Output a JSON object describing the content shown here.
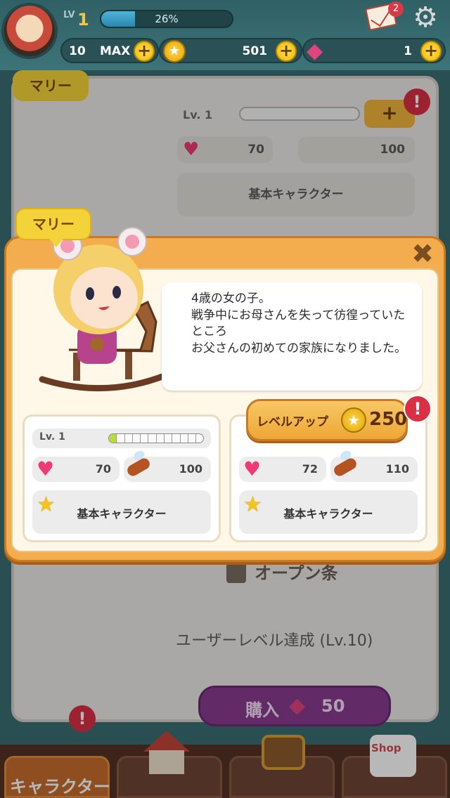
{
  "topbar": {
    "lv_tag": "LV",
    "level": "1",
    "xp_percent": "26%",
    "xp_fraction": 0.26,
    "mail_badge": "2",
    "stamina_max": "10",
    "stamina_label": "MAX",
    "coins": "501",
    "gems": "1"
  },
  "background": {
    "name": "マリー",
    "lv_label": "Lv. 1",
    "hearts": "70",
    "feed": "100",
    "type": "基本キャラクター",
    "open_label": "オープン条",
    "condition": "ユーザーレベル達成 (Lv.10)",
    "buy_label": "購入",
    "buy_price": "50"
  },
  "modal": {
    "name": "マリー",
    "description": "4歳の女の子。\n戦争中にお母さんを失って彷徨っていたところ\nお父さんの初めての家族になりました。",
    "current": {
      "lv_label": "Lv. 1",
      "lv_progress": 0.1,
      "hearts": "70",
      "feed": "100",
      "type": "基本キャラクター"
    },
    "next": {
      "hearts": "72",
      "feed": "110",
      "type": "基本キャラクター"
    },
    "levelup_label": "レベルアップ",
    "levelup_cost": "250",
    "alert": "!"
  },
  "nav": {
    "character_label": "キャラクター",
    "shop_label": "Shop"
  },
  "colors": {
    "modal": "#f3ad4e",
    "accent_gold": "#f4d33a",
    "alert": "#d93046",
    "bar_fill": "#b4df3a"
  }
}
